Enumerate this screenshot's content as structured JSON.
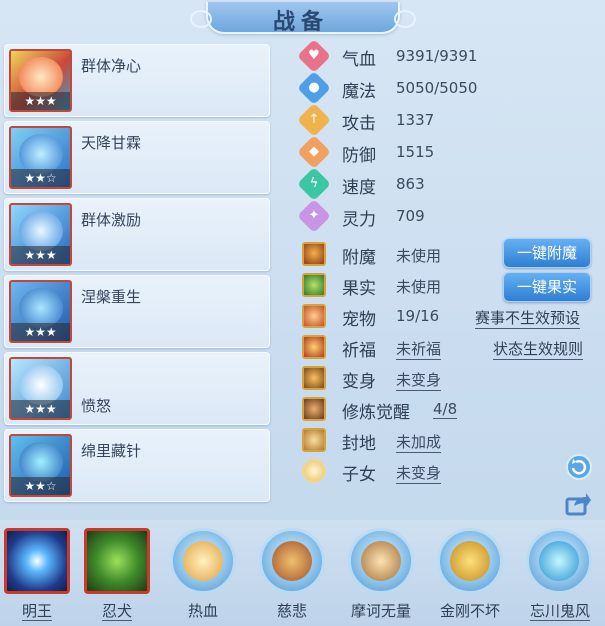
{
  "title": "战备",
  "skills": [
    {
      "name": "群体净心",
      "stars": "★★★"
    },
    {
      "name": "天降甘霖",
      "stars": "★★☆"
    },
    {
      "name": "群体激励",
      "stars": "★★★"
    },
    {
      "name": "涅槃重生",
      "stars": "★★★"
    },
    {
      "name": "愤怒",
      "stars": "★★★"
    },
    {
      "name": "绵里藏针",
      "stars": "★★☆"
    }
  ],
  "stats": [
    {
      "label": "气血",
      "value": "9391/9391",
      "icon": "heart-icon",
      "color": "#e8728a"
    },
    {
      "label": "魔法",
      "value": "5050/5050",
      "icon": "water-drop-icon",
      "color": "#4f9fe6"
    },
    {
      "label": "攻击",
      "value": "1337",
      "icon": "sword-icon",
      "color": "#f0b24a"
    },
    {
      "label": "防御",
      "value": "1515",
      "icon": "shield-icon",
      "color": "#f2a060"
    },
    {
      "label": "速度",
      "value": "863",
      "icon": "lightning-icon",
      "color": "#3cc7a4"
    },
    {
      "label": "灵力",
      "value": "709",
      "icon": "spirit-icon",
      "color": "#c795e4"
    }
  ],
  "extras": [
    {
      "label": "附魔",
      "value": "未使用"
    },
    {
      "label": "果实",
      "value": "未使用"
    },
    {
      "label": "宠物",
      "value": "19/16"
    },
    {
      "label": "祈福",
      "value": "未祈福"
    },
    {
      "label": "变身",
      "value": "未变身"
    },
    {
      "label": "修炼觉醒",
      "value": "4/8"
    },
    {
      "label": "封地",
      "value": "未加成"
    },
    {
      "label": "子女",
      "value": "未变身"
    }
  ],
  "buttons": {
    "enchant": "一键附魔",
    "fruit": "一键果实"
  },
  "links": {
    "preset": "赛事不生效预设",
    "rules": "状态生效规则"
  },
  "bottom": [
    {
      "label": "明王"
    },
    {
      "label": "忍犬"
    },
    {
      "label": "热血"
    },
    {
      "label": "慈悲"
    },
    {
      "label": "摩诃无量"
    },
    {
      "label": "金刚不坏"
    },
    {
      "label": "忘川鬼风"
    }
  ]
}
